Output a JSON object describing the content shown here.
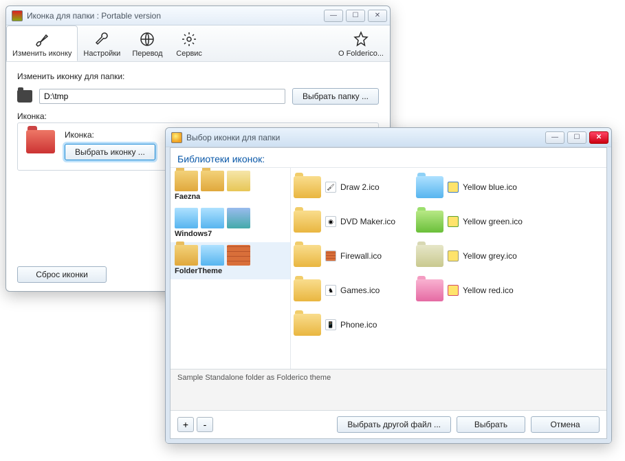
{
  "main": {
    "title": "Иконка для папки : Portable version",
    "toolbar": {
      "change_icon": "Изменить иконку",
      "settings": "Настройки",
      "translate": "Перевод",
      "service": "Сервис",
      "about": "О Folderico..."
    },
    "change_label": "Изменить иконку для папки:",
    "path_value": "D:\\tmp",
    "choose_folder": "Выбрать папку ...",
    "icon_group_label": "Иконка:",
    "icon_label": "Иконка:",
    "choose_icon": "Выбрать иконку ...",
    "reset_btn": "Сброс иконки"
  },
  "dialog": {
    "title": "Выбор иконки для папки",
    "header": "Библиотеки иконок:",
    "libs": [
      {
        "name": "Faezna"
      },
      {
        "name": "Windows7"
      },
      {
        "name": "FolderTheme"
      }
    ],
    "col1": [
      {
        "label": "Draw 2.ico"
      },
      {
        "label": "DVD Maker.ico"
      },
      {
        "label": "Firewall.ico"
      },
      {
        "label": "Games.ico"
      },
      {
        "label": "Phone.ico"
      }
    ],
    "col2": [
      {
        "label": "Yellow blue.ico"
      },
      {
        "label": "Yellow green.ico"
      },
      {
        "label": "Yellow grey.ico"
      },
      {
        "label": "Yellow red.ico"
      }
    ],
    "description": "Sample Standalone folder as Folderico theme",
    "add": "+",
    "remove": "-",
    "choose_other": "Выбрать другой файл ...",
    "choose": "Выбрать",
    "cancel": "Отмена"
  }
}
